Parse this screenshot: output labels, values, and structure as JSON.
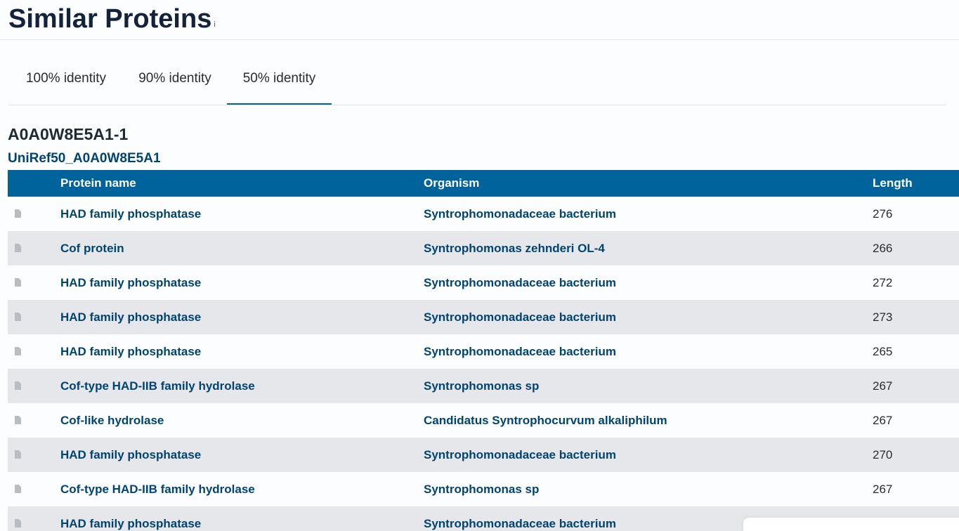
{
  "header": {
    "title": "Similar Proteins",
    "info_marker": "i"
  },
  "tabs": [
    {
      "label": "100% identity",
      "active": false
    },
    {
      "label": "90% identity",
      "active": false
    },
    {
      "label": "50% identity",
      "active": true
    }
  ],
  "entry": {
    "id": "A0A0W8E5A1-1",
    "cluster": "UniRef50_A0A0W8E5A1"
  },
  "table": {
    "columns": {
      "protein_name": "Protein name",
      "organism": "Organism",
      "length": "Length"
    },
    "rows": [
      {
        "icon": "document-icon",
        "protein_name": "HAD family phosphatase",
        "organism": "Syntrophomonadaceae bacterium",
        "length": "276"
      },
      {
        "icon": "document-icon",
        "protein_name": "Cof protein",
        "organism": "Syntrophomonas zehnderi OL-4",
        "length": "266"
      },
      {
        "icon": "document-icon",
        "protein_name": "HAD family phosphatase",
        "organism": "Syntrophomonadaceae bacterium",
        "length": "272"
      },
      {
        "icon": "document-icon",
        "protein_name": "HAD family phosphatase",
        "organism": "Syntrophomonadaceae bacterium",
        "length": "273"
      },
      {
        "icon": "document-icon",
        "protein_name": "HAD family phosphatase",
        "organism": "Syntrophomonadaceae bacterium",
        "length": "265"
      },
      {
        "icon": "document-icon",
        "protein_name": "Cof-type HAD-IIB family hydrolase",
        "organism": "Syntrophomonas sp",
        "length": "267"
      },
      {
        "icon": "document-icon",
        "protein_name": "Cof-like hydrolase",
        "organism": "Candidatus Syntrophocurvum alkaliphilum",
        "length": "267"
      },
      {
        "icon": "document-icon",
        "protein_name": "HAD family phosphatase",
        "organism": "Syntrophomonadaceae bacterium",
        "length": "270"
      },
      {
        "icon": "document-icon",
        "protein_name": "Cof-type HAD-IIB family hydrolase",
        "organism": "Syntrophomonas sp",
        "length": "267"
      },
      {
        "icon": "document-icon",
        "protein_name": "HAD family phosphatase",
        "organism": "Syntrophomonadaceae bacterium",
        "length": ""
      }
    ]
  },
  "colors": {
    "header_bg": "#00639b",
    "link": "#014371",
    "stripe": "#e5e7ea",
    "active_tab_underline": "#00639b"
  }
}
